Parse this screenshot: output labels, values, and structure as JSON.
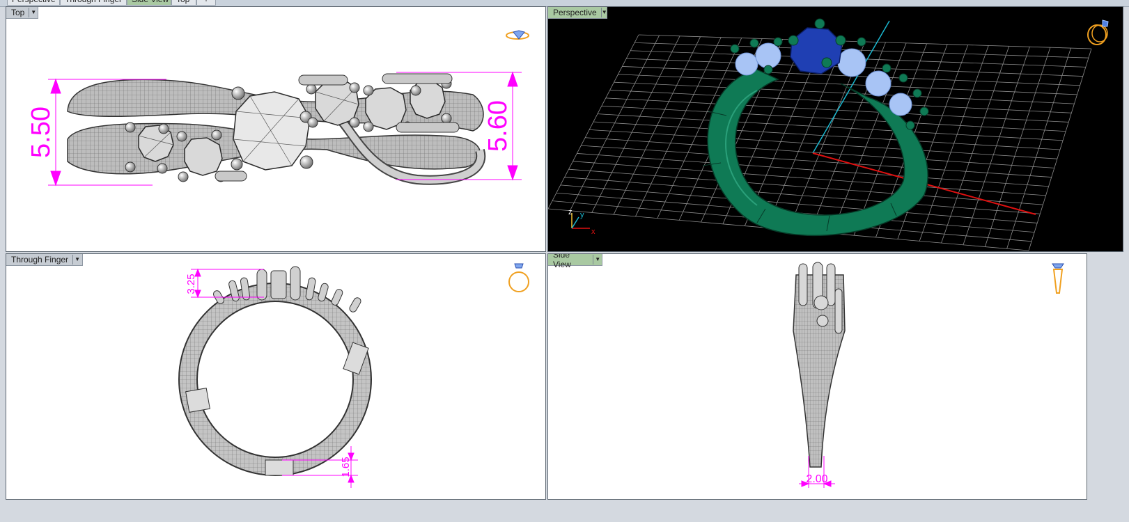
{
  "tabs": [
    {
      "label": "Perspective",
      "active": false
    },
    {
      "label": "Through Finger",
      "active": false
    },
    {
      "label": "Side View",
      "active": true
    },
    {
      "label": "Top",
      "active": false
    },
    {
      "label": "+",
      "active": false
    }
  ],
  "viewports": {
    "top": {
      "label": "Top",
      "dimensions": [
        "5.50",
        "5.60"
      ]
    },
    "perspective": {
      "label": "Perspective",
      "axes": {
        "x": "x",
        "y": "y",
        "z": "z"
      }
    },
    "through_finger": {
      "label": "Through Finger",
      "dimensions": [
        "3.25",
        "1.65"
      ]
    },
    "side_view": {
      "label": "Side View",
      "dimensions": [
        "2.00"
      ]
    }
  },
  "colors": {
    "dimension": "#ff00ff",
    "ring_metal_perspective": "#0f7a55",
    "center_stone": "#1f3fb3",
    "side_stones": "#a8c4f5",
    "grid": "#8c8c8c",
    "x_axis": "#e01010",
    "y_axis": "#1ab8d0",
    "active_label": "#a9c9a2",
    "widget_gold": "#f0a020"
  },
  "icons": [
    "ring-orientation-icon"
  ]
}
